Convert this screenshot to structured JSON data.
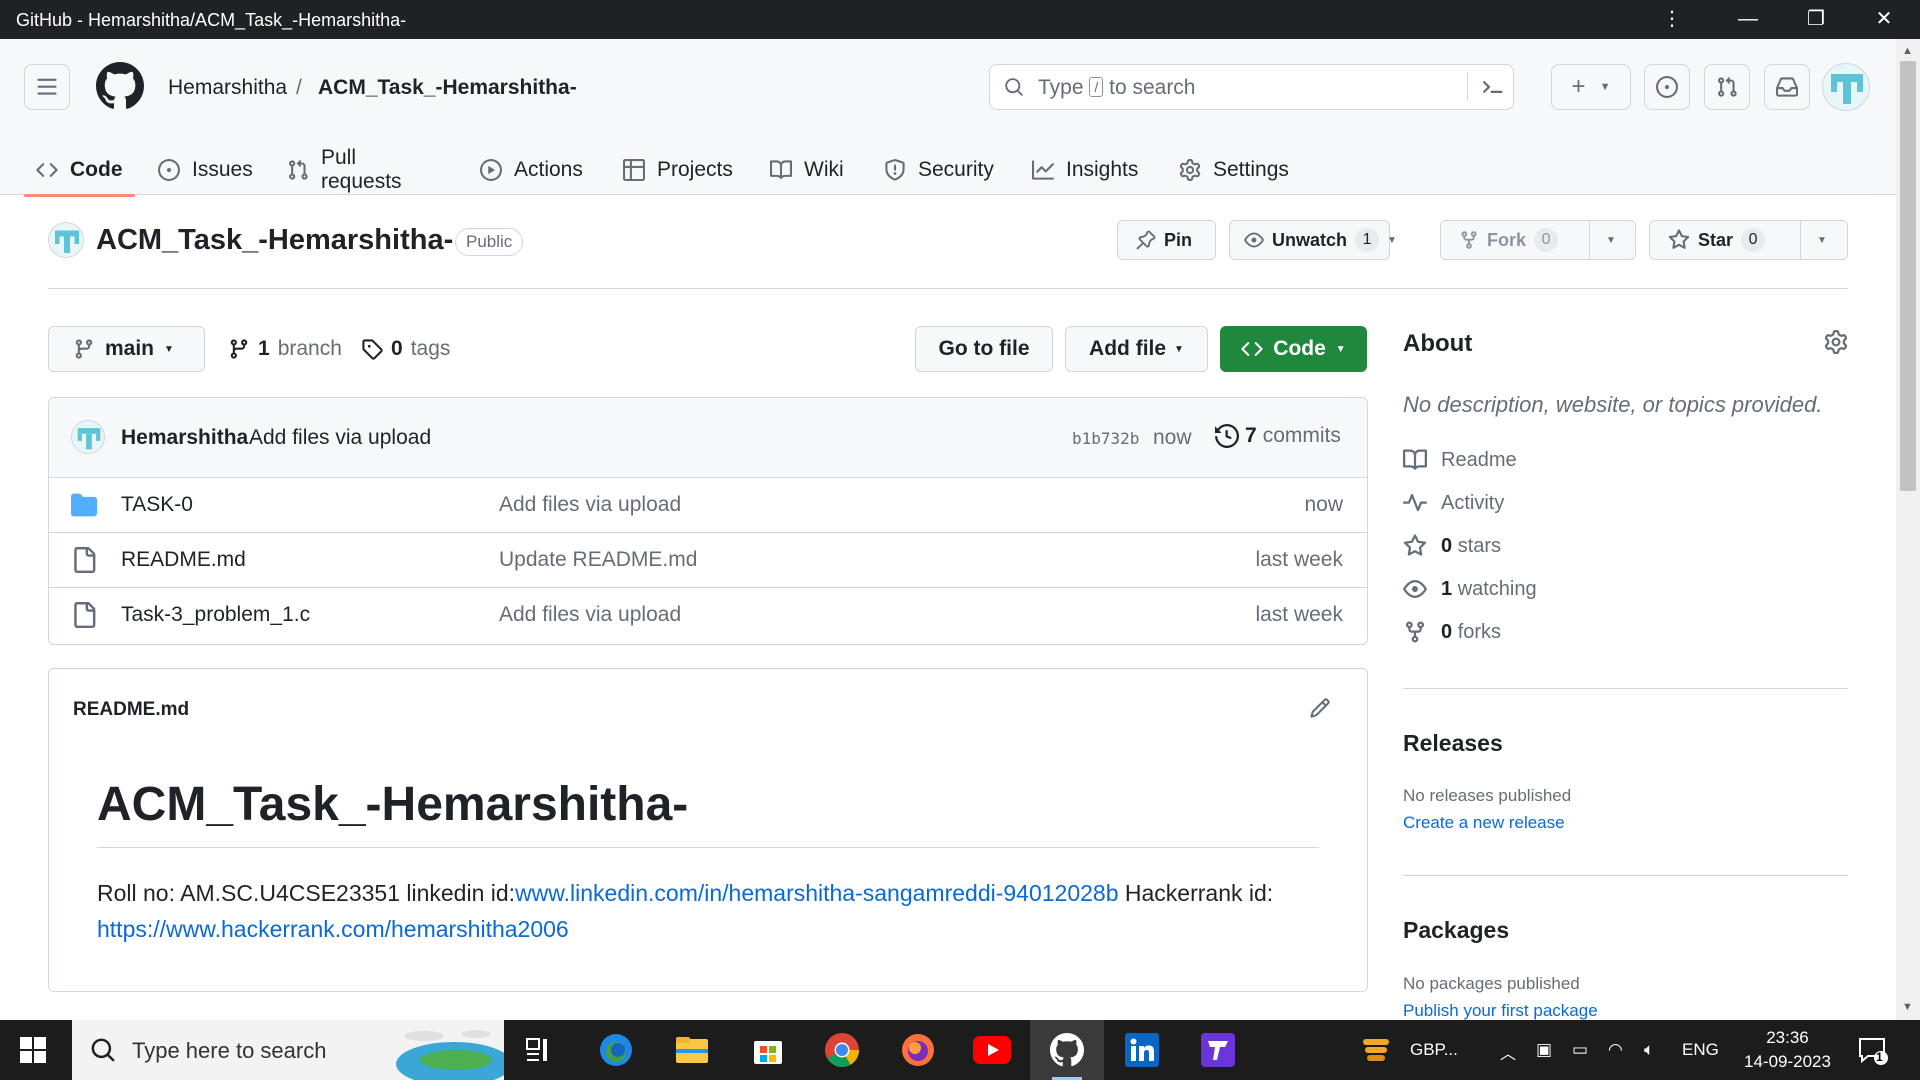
{
  "window": {
    "title": "GitHub - Hemarshitha/ACM_Task_-Hemarshitha-"
  },
  "header": {
    "owner": "Hemarshitha",
    "separator": "/",
    "repo": "ACM_Task_-Hemarshitha-",
    "search_prefix": "Type",
    "search_key": "/",
    "search_suffix": "to search"
  },
  "tabs": [
    {
      "label": "Code",
      "icon": "code-icon"
    },
    {
      "label": "Issues",
      "icon": "issue-icon"
    },
    {
      "label": "Pull requests",
      "icon": "pull-request-icon"
    },
    {
      "label": "Actions",
      "icon": "play-icon"
    },
    {
      "label": "Projects",
      "icon": "table-icon"
    },
    {
      "label": "Wiki",
      "icon": "book-icon"
    },
    {
      "label": "Security",
      "icon": "shield-icon"
    },
    {
      "label": "Insights",
      "icon": "graph-icon"
    },
    {
      "label": "Settings",
      "icon": "gear-icon"
    }
  ],
  "repo": {
    "name": "ACM_Task_-Hemarshitha-",
    "visibility": "Public",
    "pin_label": "Pin",
    "unwatch_label": "Unwatch",
    "watch_count": "1",
    "fork_label": "Fork",
    "fork_count": "0",
    "star_label": "Star",
    "star_count": "0"
  },
  "toolbar": {
    "branch": "main",
    "branch_count": "1",
    "branch_word": "branch",
    "tag_count": "0",
    "tag_word": "tags",
    "goto_file": "Go to file",
    "add_file": "Add file",
    "code": "Code"
  },
  "latest_commit": {
    "author": "Hemarshitha",
    "message": "Add files via upload",
    "sha": "b1b732b",
    "time": "now",
    "commit_count": "7",
    "commit_word": "commits"
  },
  "files": [
    {
      "name": "TASK-0",
      "type": "folder",
      "message": "Add files via upload",
      "time": "now"
    },
    {
      "name": "README.md",
      "type": "file",
      "message": "Update README.md",
      "time": "last week"
    },
    {
      "name": "Task-3_problem_1.c",
      "type": "file",
      "message": "Add files via upload",
      "time": "last week"
    }
  ],
  "readme": {
    "filename": "README.md",
    "heading": "ACM_Task_-Hemarshitha-",
    "text1": "Roll no: AM.SC.U4CSE23351 linkedin id:",
    "link1": "www.linkedin.com/in/hemarshitha-sangamreddi-94012028b",
    "text2": " Hackerrank id: ",
    "link2": "https://www.hackerrank.com/hemarshitha2006"
  },
  "about": {
    "title": "About",
    "description": "No description, website, or topics provided.",
    "items": [
      {
        "icon": "book-icon",
        "count": "",
        "label": "Readme"
      },
      {
        "icon": "pulse-icon",
        "count": "",
        "label": "Activity"
      },
      {
        "icon": "star-icon",
        "count": "0",
        "label": "stars"
      },
      {
        "icon": "eye-icon",
        "count": "1",
        "label": "watching"
      },
      {
        "icon": "fork-icon",
        "count": "0",
        "label": "forks"
      }
    ]
  },
  "releases": {
    "title": "Releases",
    "empty": "No releases published",
    "link": "Create a new release"
  },
  "packages": {
    "title": "Packages",
    "empty": "No packages published",
    "link": "Publish your first package"
  },
  "taskbar": {
    "search_placeholder": "Type here to search",
    "weather": "GBP...",
    "language": "ENG",
    "time": "23:36",
    "date": "14-09-2023",
    "notifications": "1"
  }
}
